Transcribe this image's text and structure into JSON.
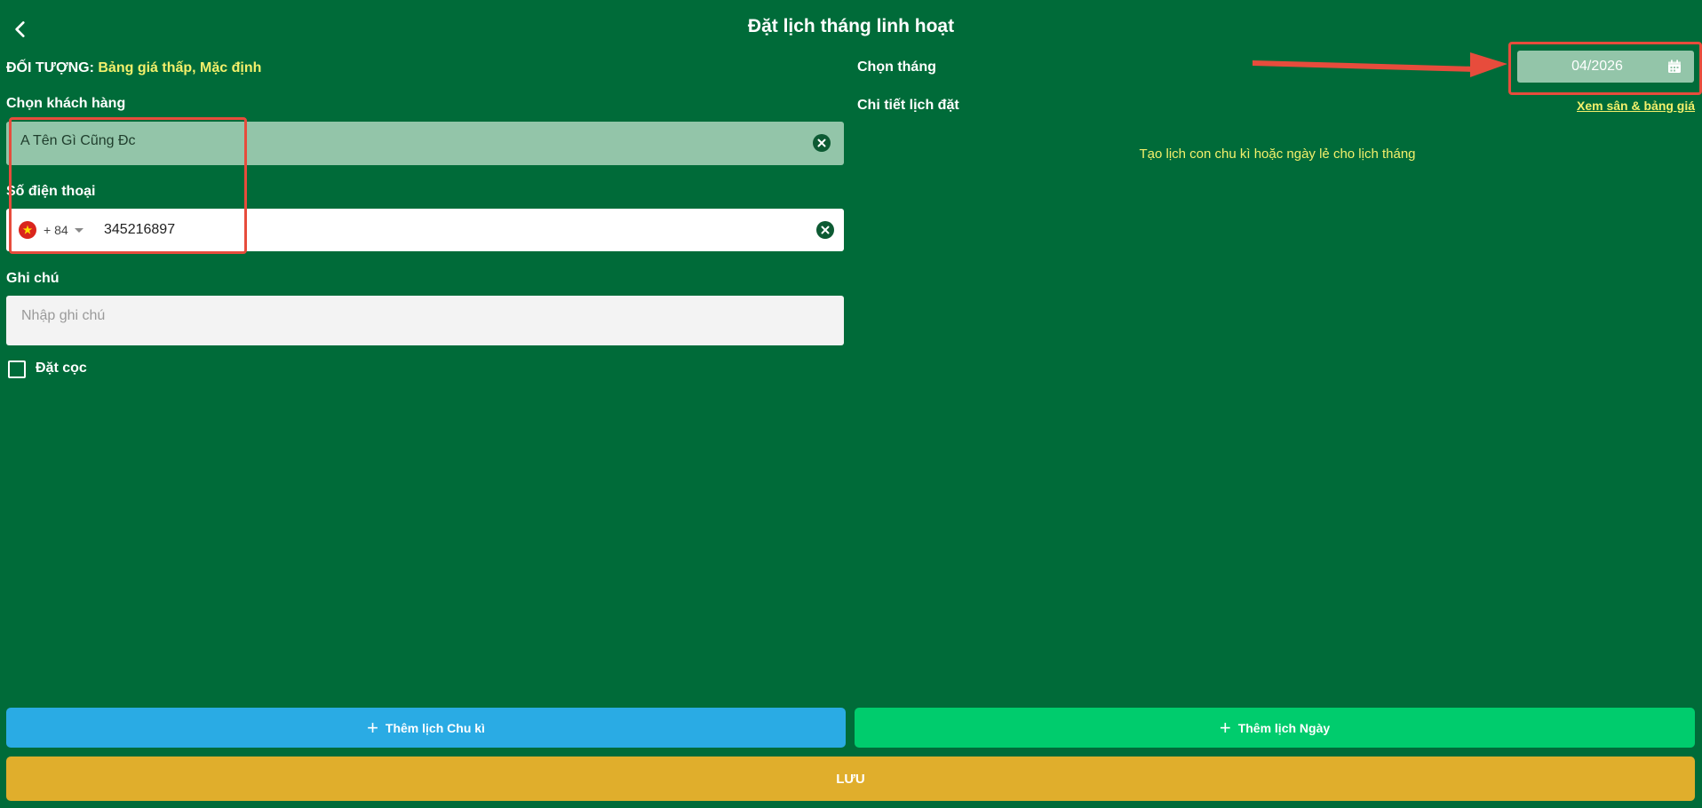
{
  "header": {
    "title": "Đặt lịch tháng linh hoạt"
  },
  "target": {
    "label": "ĐỐI TƯỢNG:",
    "value": "Bảng giá thấp, Mặc định"
  },
  "customer": {
    "label": "Chọn khách hàng",
    "value": "A Tên Gì Cũng Đc"
  },
  "phone": {
    "label": "Số điện thoại",
    "dial_code": "+ 84",
    "value": "345216897",
    "flag": "vietnam-flag"
  },
  "note": {
    "label": "Ghi chú",
    "placeholder": "Nhập ghi chú"
  },
  "deposit": {
    "label": "Đặt cọc",
    "checked": false
  },
  "month": {
    "label": "Chọn tháng",
    "value": "04/2026"
  },
  "details": {
    "label": "Chi tiết lịch đặt",
    "link": "Xem sân & bảng giá",
    "empty_message": "Tạo lịch con chu kì hoặc ngày lẻ cho lịch tháng"
  },
  "buttons": {
    "add_cycle": "Thêm lịch Chu kì",
    "add_day": "Thêm lịch Ngày",
    "save": "LƯU"
  },
  "colors": {
    "background": "#006b39",
    "accent_yellow": "#f3f06b",
    "blue": "#2aabe4",
    "green": "#00cc6d",
    "gold": "#e0ae2c",
    "highlight": "#e74c3c"
  }
}
